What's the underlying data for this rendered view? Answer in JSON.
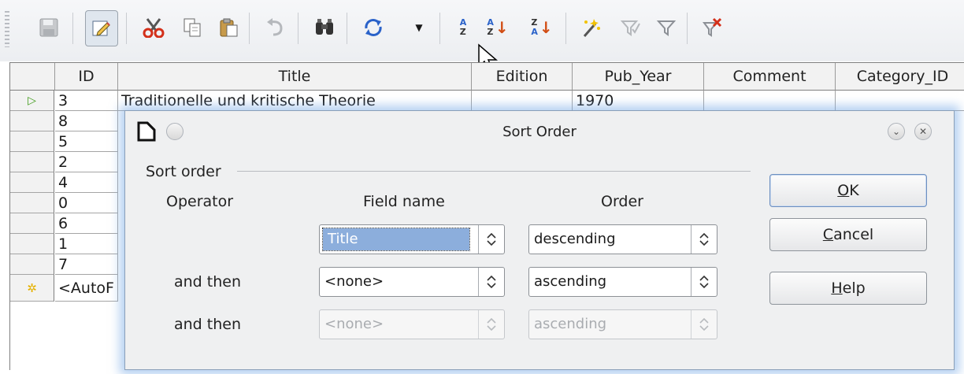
{
  "toolbar": {
    "icons": [
      "save-record-icon",
      "edit-data-icon",
      "cut-icon",
      "copy-icon",
      "paste-icon",
      "undo-icon",
      "find-icon",
      "refresh-icon",
      "refresh-dropdown-icon",
      "sort-icon",
      "sort-ascending-icon",
      "sort-descending-icon",
      "autofilter-icon",
      "standard-filter-icon",
      "apply-filter-icon",
      "remove-filter-icon"
    ]
  },
  "grid": {
    "columns": [
      "ID",
      "Title",
      "Edition",
      "Pub_Year",
      "Comment",
      "Category_ID"
    ],
    "rows": [
      {
        "id": "3",
        "title": "Traditionelle und kritische Theorie",
        "pub_year": "1970"
      },
      {
        "id": "8"
      },
      {
        "id": "5"
      },
      {
        "id": "2"
      },
      {
        "id": "4"
      },
      {
        "id": "0"
      },
      {
        "id": "6"
      },
      {
        "id": "1"
      },
      {
        "id": "7"
      },
      {
        "id": "<AutoF"
      }
    ]
  },
  "dialog": {
    "title": "Sort Order",
    "group_label": "Sort order",
    "headers": {
      "operator": "Operator",
      "field": "Field name",
      "order": "Order"
    },
    "rows": [
      {
        "operator": "",
        "field": "Title",
        "order": "descending",
        "enabled": true
      },
      {
        "operator": "and then",
        "field": "<none>",
        "order": "ascending",
        "enabled": true
      },
      {
        "operator": "and then",
        "field": "<none>",
        "order": "ascending",
        "enabled": false
      }
    ],
    "buttons": {
      "ok": {
        "pre": "",
        "mn": "O",
        "post": "K"
      },
      "cancel": {
        "pre": "",
        "mn": "C",
        "post": "ancel"
      },
      "help": {
        "pre": "",
        "mn": "H",
        "post": "elp"
      }
    }
  }
}
